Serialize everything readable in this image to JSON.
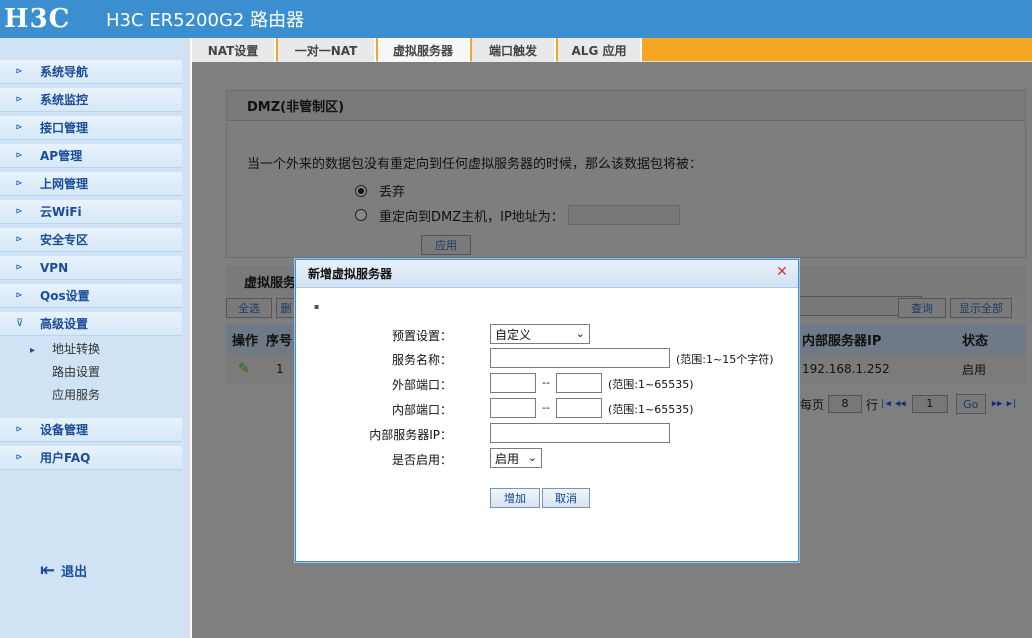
{
  "header": {
    "logo": "H3C",
    "title": "H3C ER5200G2 路由器"
  },
  "sidebar": {
    "items": [
      {
        "label": "系统导航",
        "arrow": "⊳"
      },
      {
        "label": "系统监控",
        "arrow": "⊳"
      },
      {
        "label": "接口管理",
        "arrow": "⊳"
      },
      {
        "label": "AP管理",
        "arrow": "⊳"
      },
      {
        "label": "上网管理",
        "arrow": "⊳"
      },
      {
        "label": "云WiFi",
        "arrow": "⊳"
      },
      {
        "label": "安全专区",
        "arrow": "⊳"
      },
      {
        "label": "VPN",
        "arrow": "⊳"
      },
      {
        "label": "Qos设置",
        "arrow": "⊳"
      },
      {
        "label": "高级设置",
        "arrow": "⊽"
      }
    ],
    "sub_items": [
      "地址转换",
      "路由设置",
      "应用服务"
    ],
    "items2": [
      {
        "label": "设备管理",
        "arrow": "⊳"
      },
      {
        "label": "用户FAQ",
        "arrow": "⊳"
      }
    ],
    "logout": "退出"
  },
  "tabs": [
    "NAT设置",
    "一对一NAT",
    "虚拟服务器",
    "端口触发",
    "ALG 应用"
  ],
  "dmz": {
    "title": "DMZ(非管制区)",
    "description": "当一个外来的数据包没有重定向到任何虚拟服务器的时候，那么该数据包将被：",
    "option_drop": "丢弃",
    "option_redirect": "重定向到DMZ主机，IP地址为：",
    "apply": "应用"
  },
  "virtual_server": {
    "title": "虚拟服务",
    "select_all": "全选",
    "del_short": "删",
    "query": "查询",
    "show_all": "显示全部",
    "columns": {
      "op": "操作",
      "seq": "序号",
      "ip": "内部服务器IP",
      "status": "状态"
    },
    "rows": [
      {
        "seq": "1",
        "ip": "192.168.1.252",
        "status": "启用"
      }
    ],
    "pager": {
      "per_page_label": "每页",
      "per_page": "8",
      "rows_label": "行",
      "page": "1",
      "go": "Go"
    }
  },
  "modal": {
    "title": "新增虚拟服务器",
    "preset_label": "预置设置：",
    "preset_value": "自定义",
    "name_label": "服务名称：",
    "name_hint": "(范围:1~15个字符)",
    "ext_port_label": "外部端口：",
    "int_port_label": "内部端口：",
    "port_hint": "(范围:1~65535)",
    "port_dash": "--",
    "server_ip_label": "内部服务器IP：",
    "enable_label": "是否启用：",
    "enable_value": "启用",
    "add": "增加",
    "cancel": "取消"
  }
}
